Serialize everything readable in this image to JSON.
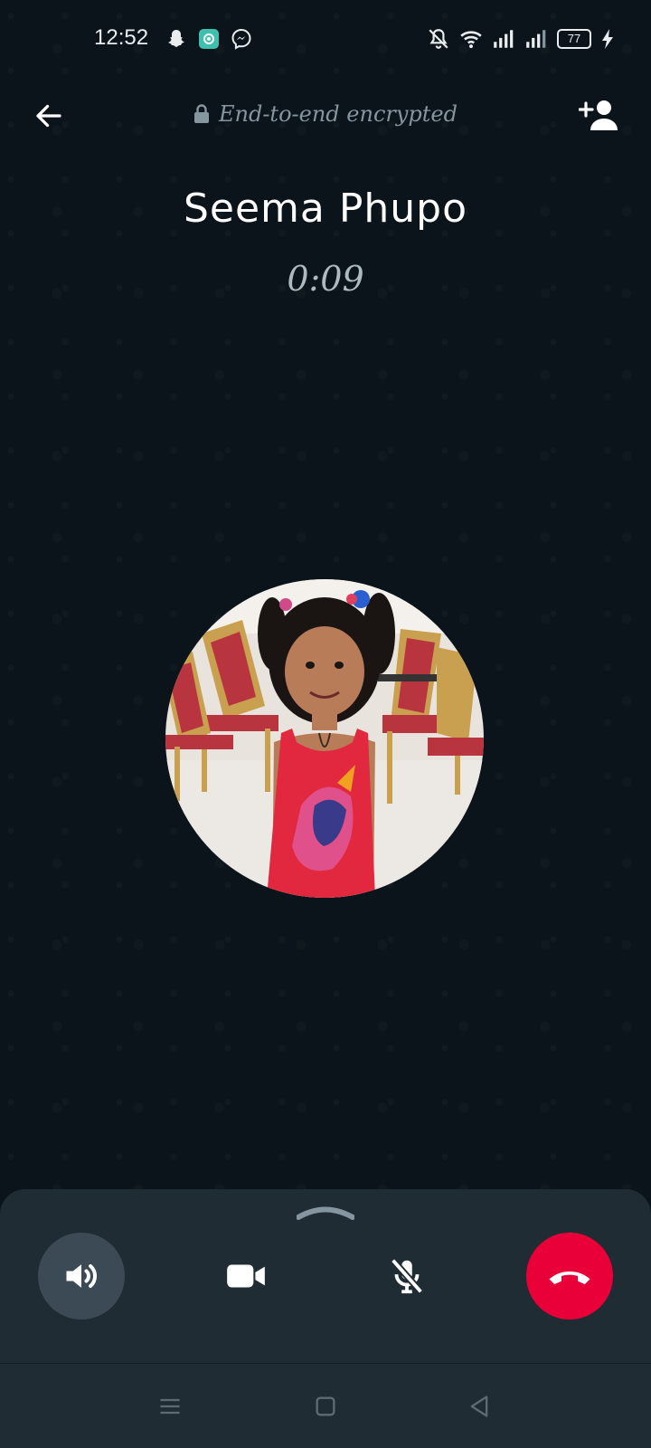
{
  "status_bar": {
    "time": "12:52",
    "battery": "77",
    "left_icons": [
      "snapchat-icon",
      "app-icon",
      "messenger-icon"
    ],
    "right_icons": [
      "muted-bell-icon",
      "wifi-icon",
      "signal-icon",
      "signal-icon",
      "battery-icon",
      "charging-icon"
    ]
  },
  "header": {
    "encryption_text": "End-to-end encrypted"
  },
  "call": {
    "caller_name": "Seema Phupo",
    "duration": "0:09"
  },
  "controls": {
    "speaker": "speaker-icon",
    "video": "video-icon",
    "mute": "mic-off-icon",
    "end_call": "end-call-icon"
  },
  "colors": {
    "background": "#0b141a",
    "panel": "#1f2c34",
    "end_call": "#ea0038",
    "speaker_active": "#3b4a54",
    "muted_text": "#8696a0"
  },
  "navigation": [
    "menu-icon",
    "home-icon",
    "back-icon"
  ]
}
